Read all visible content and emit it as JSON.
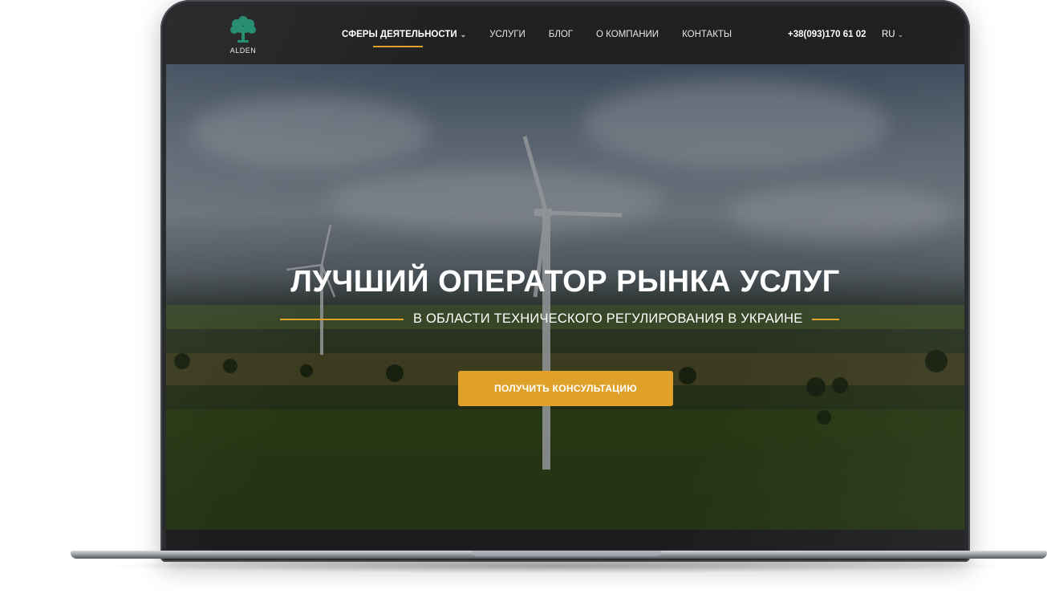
{
  "header": {
    "logo_text": "ALDEN",
    "nav": [
      {
        "label": "СФЕРЫ ДЕЯТЕЛЬНОСТИ",
        "has_dropdown": true,
        "active": true
      },
      {
        "label": "УСЛУГИ"
      },
      {
        "label": "БЛОГ"
      },
      {
        "label": "О КОМПАНИИ"
      },
      {
        "label": "КОНТАКТЫ"
      }
    ],
    "phone": "+38(093)170 61 02",
    "language": "RU"
  },
  "hero": {
    "title": "ЛУЧШИЙ ОПЕРАТОР РЫНКА УСЛУГ",
    "subtitle": "В ОБЛАСТИ ТЕХНИЧЕСКОГО РЕГУЛИРОВАНИЯ В УКРАИНЕ",
    "cta_label": "ПОЛУЧИТЬ КОНСУЛЬТАЦИЮ"
  },
  "colors": {
    "accent": "#e0a12a",
    "header_bg": "#1f2021",
    "logo_green": "#1f8a6a"
  },
  "icons": {
    "logo": "tree-icon",
    "dropdown": "chevron-down-icon"
  }
}
